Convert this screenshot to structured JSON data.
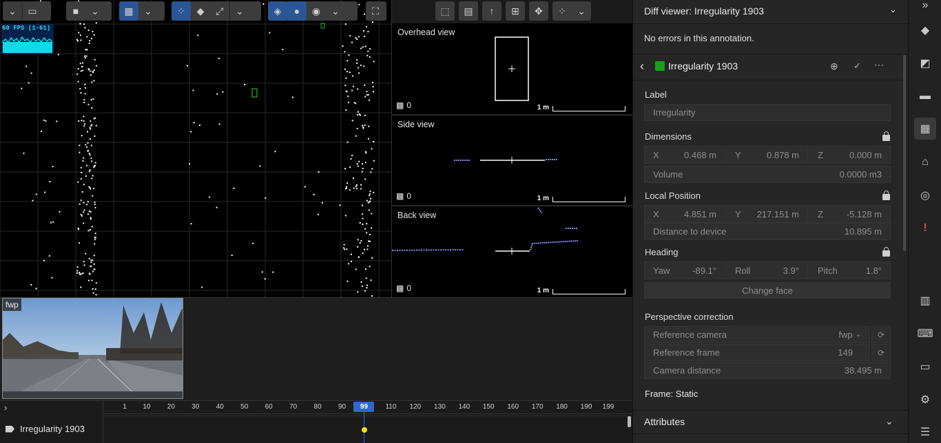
{
  "viewport": {
    "fps_label": "60 FPS (1-61)"
  },
  "ortho_views": [
    {
      "title": "Overhead view",
      "count": "0",
      "scale": "1 m"
    },
    {
      "title": "Side view",
      "count": "0",
      "scale": "1 m"
    },
    {
      "title": "Back view",
      "count": "0",
      "scale": "1 m"
    }
  ],
  "camera": {
    "label": "fwp"
  },
  "timeline": {
    "ticks": [
      "1",
      "10",
      "20",
      "30",
      "40",
      "50",
      "60",
      "70",
      "80",
      "90",
      "99",
      "110",
      "120",
      "130",
      "140",
      "150",
      "160",
      "170",
      "180",
      "190",
      "199"
    ],
    "current_frame": "99",
    "track_label": "Irregularity 1903"
  },
  "panel": {
    "header_title": "Diff viewer: Irregularity 1903",
    "diff_message": "No errors in this annotation.",
    "annotation_title": "Irregularity 1903",
    "annotation_color": "#1a9e1a",
    "label_heading": "Label",
    "label_value": "Irregularity",
    "dimensions_heading": "Dimensions",
    "dims": {
      "x_key": "X",
      "x": "0.468 m",
      "y_key": "Y",
      "y": "0.878 m",
      "z_key": "Z",
      "z": "0.000 m"
    },
    "volume_key": "Volume",
    "volume": "0.0000 m3",
    "local_position_heading": "Local Position",
    "pos": {
      "x_key": "X",
      "x": "4.851 m",
      "y_key": "Y",
      "y": "217.151 m",
      "z_key": "Z",
      "z": "-5.128 m"
    },
    "distance_key": "Distance to device",
    "distance": "10.895 m",
    "heading_heading": "Heading",
    "heading": {
      "yaw_key": "Yaw",
      "yaw": "-89.1°",
      "roll_key": "Roll",
      "roll": "3.9°",
      "pitch_key": "Pitch",
      "pitch": "1.8°"
    },
    "change_face_label": "Change face",
    "perspective_heading": "Perspective correction",
    "ref_camera_key": "Reference camera",
    "ref_camera": "fwp",
    "ref_frame_key": "Reference frame",
    "ref_frame": "149",
    "cam_distance_key": "Camera distance",
    "cam_distance": "38.495 m",
    "frame_static": "Frame: Static",
    "attributes_heading": "Attributes"
  }
}
